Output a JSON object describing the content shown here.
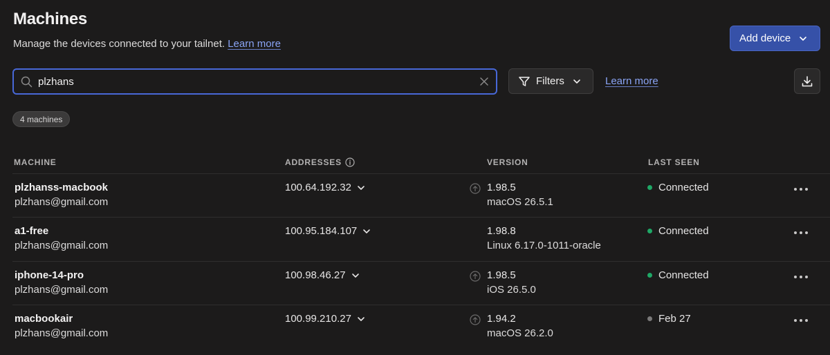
{
  "header": {
    "title": "Machines",
    "subtitle": "Manage the devices connected to your tailnet.",
    "learn_more": "Learn more",
    "add_device": "Add device"
  },
  "search": {
    "value": "plzhans"
  },
  "toolbar": {
    "filters": "Filters",
    "learn_more": "Learn more"
  },
  "count_badge": "4 machines",
  "columns": {
    "machine": "MACHINE",
    "addresses": "ADDRESSES",
    "version": "VERSION",
    "last_seen": "LAST SEEN"
  },
  "machines": [
    {
      "name": "plzhanss-macbook",
      "owner": "plzhans@gmail.com",
      "address": "100.64.192.32",
      "version": "1.98.5",
      "os": "macOS 26.5.1",
      "update_available": true,
      "last_seen": "Connected",
      "status_color": "#1fa866"
    },
    {
      "name": "a1-free",
      "owner": "plzhans@gmail.com",
      "address": "100.95.184.107",
      "version": "1.98.8",
      "os": "Linux 6.17.0-1011-oracle",
      "update_available": false,
      "last_seen": "Connected",
      "status_color": "#1fa866"
    },
    {
      "name": "iphone-14-pro",
      "owner": "plzhans@gmail.com",
      "address": "100.98.46.27",
      "version": "1.98.5",
      "os": "iOS 26.5.0",
      "update_available": true,
      "last_seen": "Connected",
      "status_color": "#1fa866"
    },
    {
      "name": "macbookair",
      "owner": "plzhans@gmail.com",
      "address": "100.99.210.27",
      "version": "1.94.2",
      "os": "macOS 26.2.0",
      "update_available": true,
      "last_seen": "Feb 27",
      "status_color": "#7a7979"
    }
  ],
  "colors": {
    "accent": "#3651a8",
    "link": "#8aa4f5",
    "connected": "#1fa866",
    "offline": "#7a7979"
  }
}
